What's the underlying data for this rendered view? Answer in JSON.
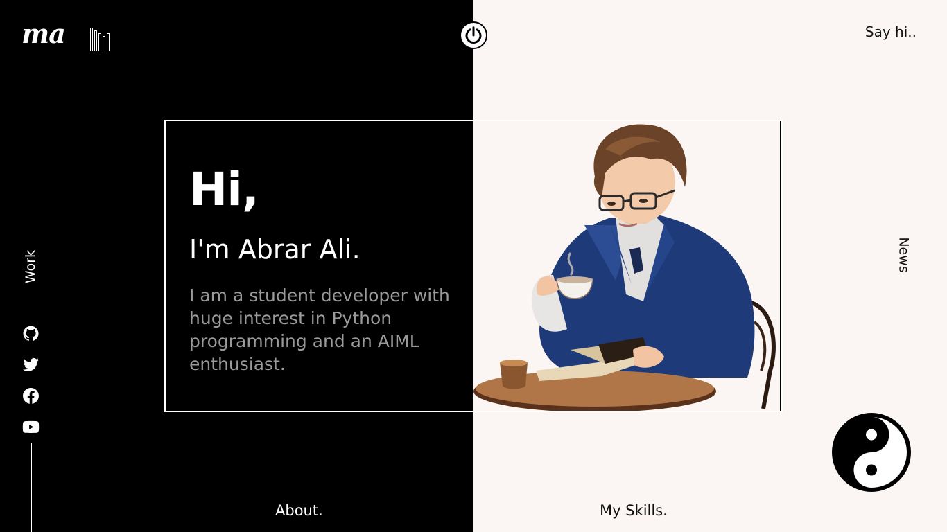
{
  "header": {
    "logo": "ma",
    "say_hi": "Say hi.."
  },
  "nav": {
    "work": "Work",
    "news": "News",
    "about": "About.",
    "skills": "My Skills."
  },
  "hero": {
    "greeting": "Hi,",
    "name": "I'm Abrar Ali.",
    "bio": "I am a student developer with huge interest in Python programming and an AIML enthusiast."
  },
  "socials": [
    "github-icon",
    "twitter-icon",
    "facebook-icon",
    "youtube-icon"
  ],
  "colors": {
    "dark": "#000000",
    "light": "#fbf6f3",
    "muted_text": "#9a9a9a"
  }
}
